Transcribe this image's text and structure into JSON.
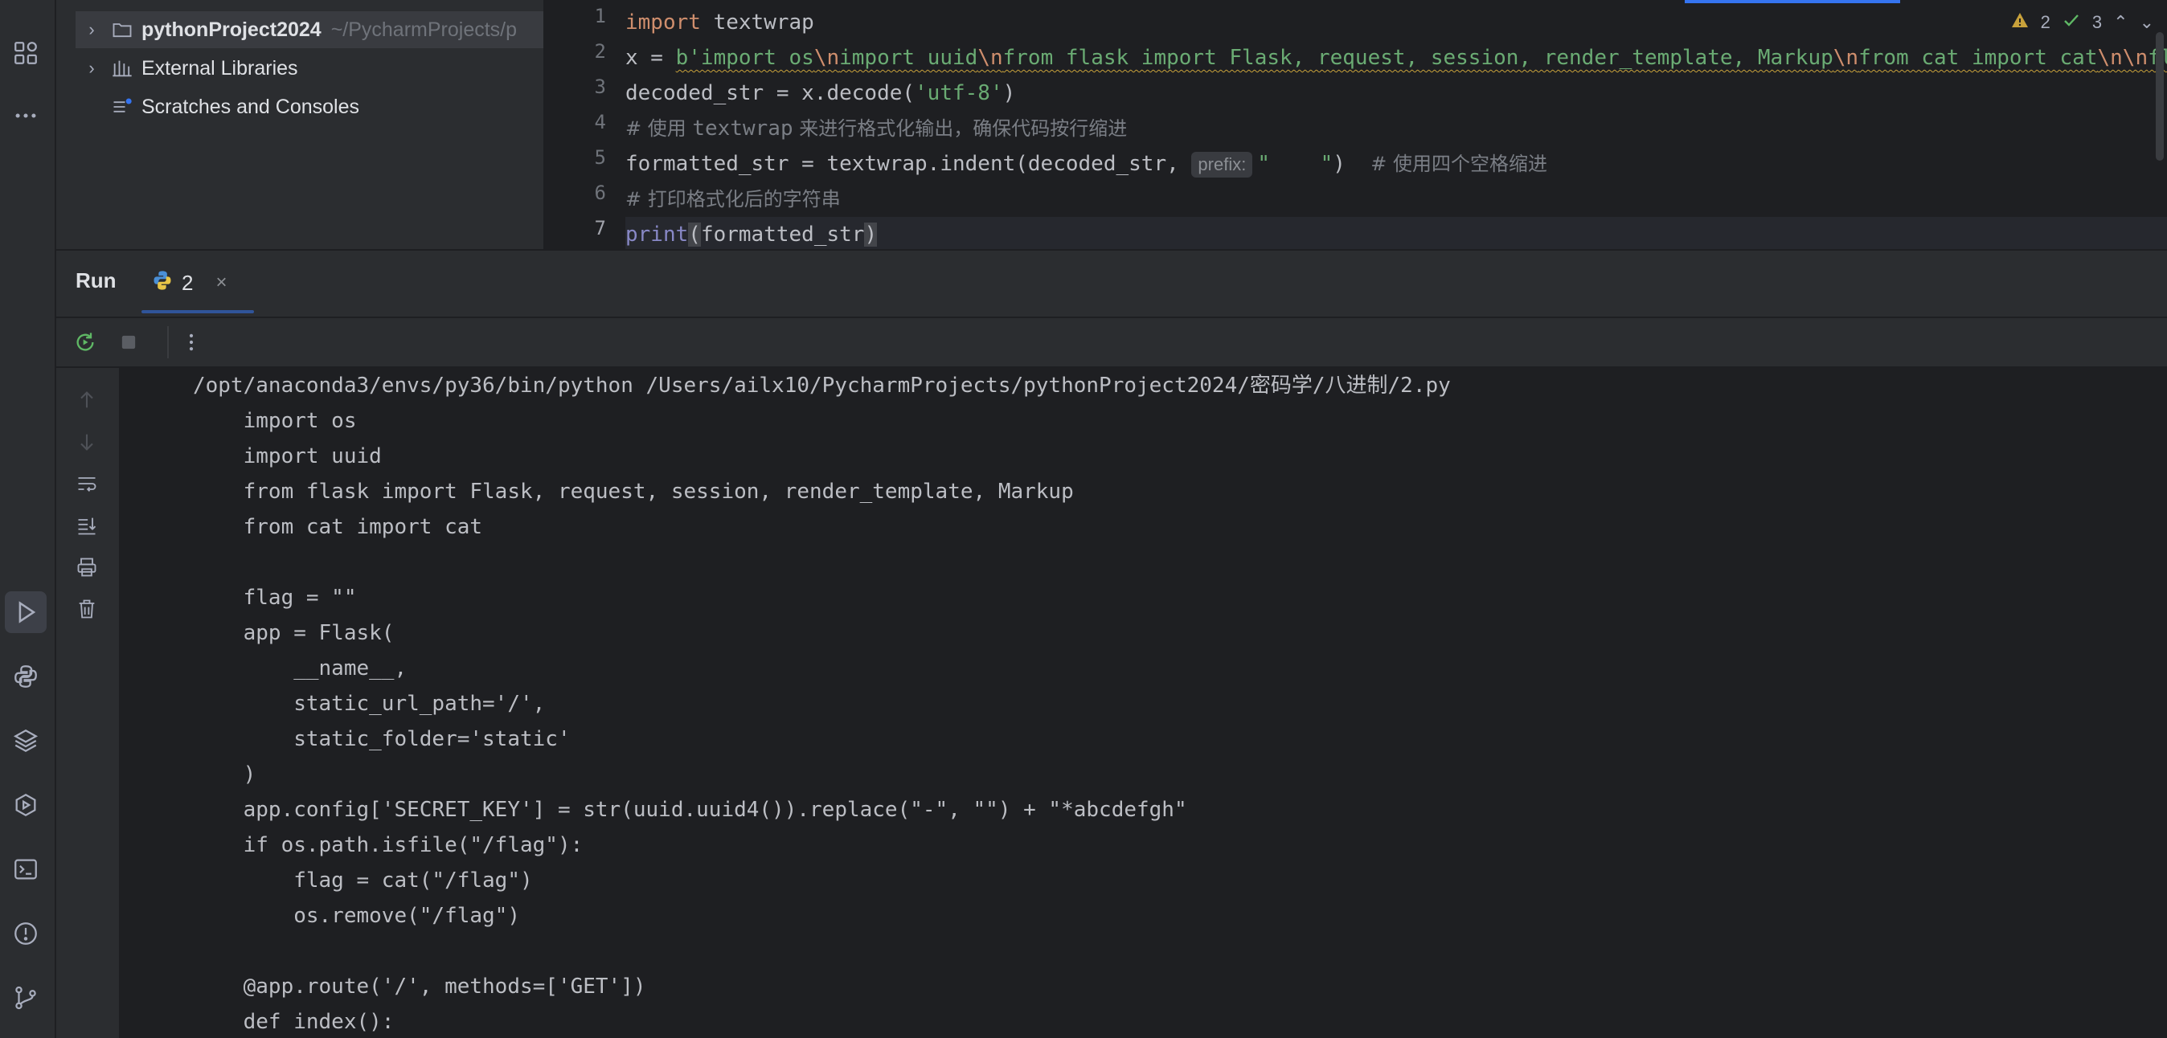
{
  "project_tree": {
    "root_name": "pythonProject2024",
    "root_path": "~/PycharmProjects/p",
    "external_libraries": "External Libraries",
    "scratches": "Scratches and Consoles"
  },
  "editor": {
    "line_numbers": [
      "1",
      "2",
      "3",
      "4",
      "5",
      "6",
      "7"
    ],
    "lines": {
      "l1_kw": "import",
      "l1_rest": " textwrap",
      "l2_pre": "x = ",
      "l2_b": "b'import os",
      "l2_e1": "\\n",
      "l2_m1": "import uuid",
      "l2_e2": "\\n",
      "l2_m2": "from flask import Flask, request, session, render_template, Markup",
      "l2_e3": "\\n",
      "l2_m3": "from cat import cat",
      "l2_e4": "\\n\\n",
      "l2_m4": "fl",
      "l3_a": "decoded_str = x.decode(",
      "l3_s": "'utf-8'",
      "l3_b": ")",
      "l4_hash": "# 使用 ",
      "l4_mid": "textwrap",
      "l4_cn": " 来进行格式化输出，确保代码按行缩进",
      "l5_a": "formatted_str = textwrap.indent(decoded_str, ",
      "l5_hint": "prefix:",
      "l5_s": "\"    \"",
      "l5_b": ")  ",
      "l5_cm": "# 使用四个空格缩进",
      "l6_cm": "# 打印格式化后的字符串",
      "l7_bi": "print",
      "l7_p1": "(",
      "l7_arg": "formatted_str",
      "l7_p2": ")"
    },
    "inspections": {
      "warnings": "2",
      "weak_warnings": "3"
    }
  },
  "run_panel": {
    "title": "Run",
    "tab_label": "2",
    "output": [
      "/opt/anaconda3/envs/py36/bin/python /Users/ailx10/PycharmProjects/pythonProject2024/密码学/八进制/2.py",
      "    import os",
      "    import uuid",
      "    from flask import Flask, request, session, render_template, Markup",
      "    from cat import cat",
      "",
      "    flag = \"\"",
      "    app = Flask(",
      "        __name__,",
      "        static_url_path='/',",
      "        static_folder='static'",
      "    )",
      "    app.config['SECRET_KEY'] = str(uuid.uuid4()).replace(\"-\", \"\") + \"*abcdefgh\"",
      "    if os.path.isfile(\"/flag\"):",
      "        flag = cat(\"/flag\")",
      "        os.remove(\"/flag\")",
      "",
      "    @app.route('/', methods=['GET'])",
      "    def index():"
    ]
  },
  "colors": {
    "accent": "#3574f0",
    "keyword": "#cf8e6d",
    "string": "#6aab73",
    "comment": "#7a7e85",
    "warning": "#c8a13b",
    "ok": "#5fb865"
  }
}
